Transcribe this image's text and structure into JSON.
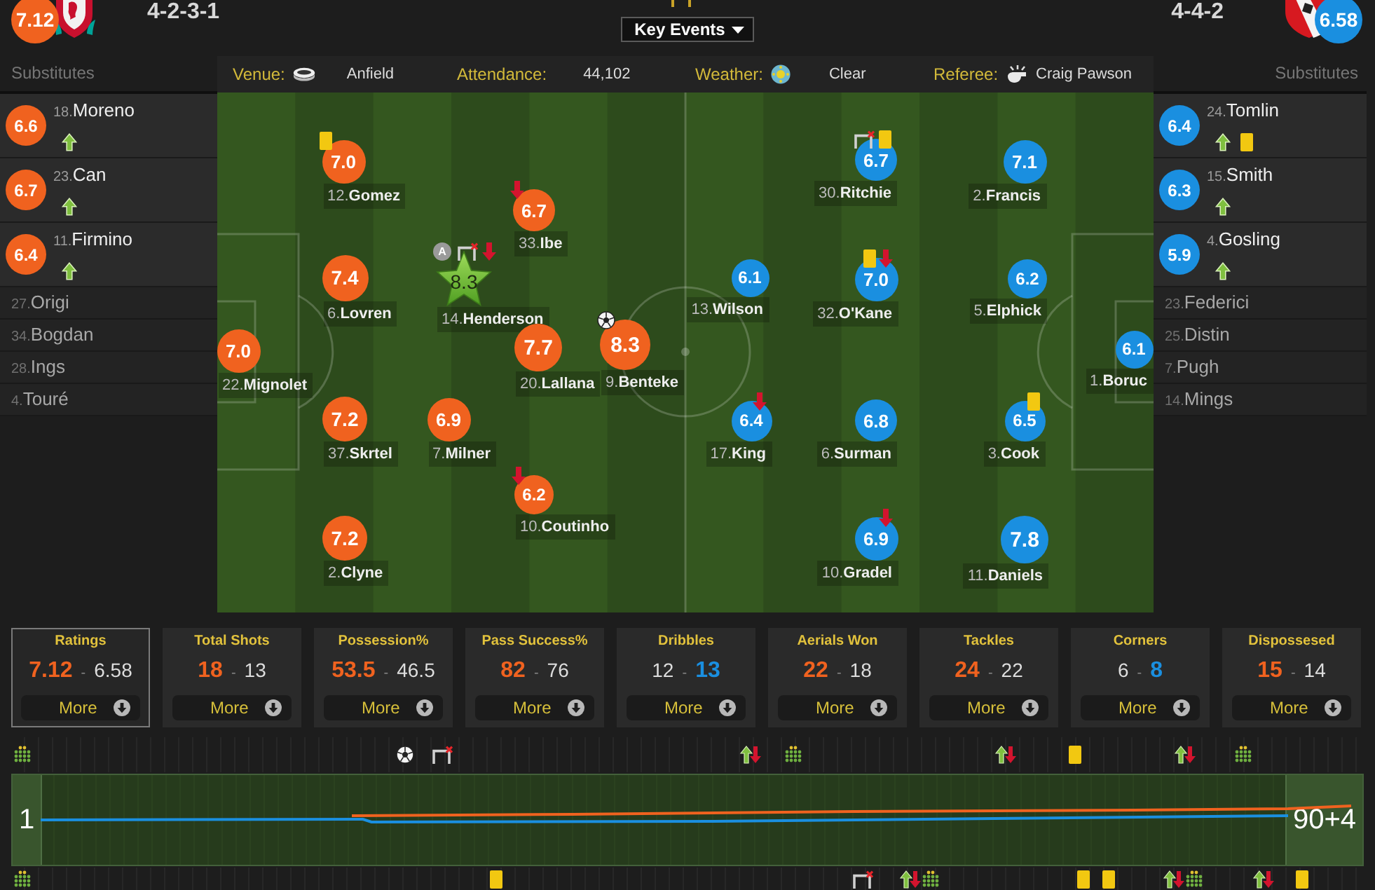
{
  "header": {
    "key_events": "Key Events"
  },
  "teams": [
    {
      "color": "#f0621f",
      "rating": "7.12",
      "formation": "4-2-3-1",
      "substitutes_title": "Substitutes",
      "substitutes": [
        {
          "number": "18.",
          "name": "Moreno",
          "played": true,
          "rating": "6.6",
          "events": [
            {
              "kind": "sub-on"
            }
          ]
        },
        {
          "number": "23.",
          "name": "Can",
          "played": true,
          "rating": "6.7",
          "events": [
            {
              "kind": "sub-on"
            }
          ]
        },
        {
          "number": "11.",
          "name": "Firmino",
          "played": true,
          "rating": "6.4",
          "events": [
            {
              "kind": "sub-on"
            }
          ]
        },
        {
          "number": "27.",
          "name": "Origi",
          "played": false
        },
        {
          "number": "34.",
          "name": "Bogdan",
          "played": false
        },
        {
          "number": "28.",
          "name": "Ings",
          "played": false
        },
        {
          "number": "4.",
          "name": "Touré",
          "played": false
        }
      ],
      "players": [
        {
          "number": "22.",
          "name": "Mignolet",
          "rating": "7.0",
          "motm": false
        },
        {
          "number": "12.",
          "name": "Gomez",
          "rating": "7.0",
          "motm": false,
          "events": [
            {
              "kind": "yellow-card"
            }
          ]
        },
        {
          "number": "6.",
          "name": "Lovren",
          "rating": "7.4",
          "motm": false
        },
        {
          "number": "37.",
          "name": "Skrtel",
          "rating": "7.2",
          "motm": false
        },
        {
          "number": "2.",
          "name": "Clyne",
          "rating": "7.2",
          "motm": false
        },
        {
          "number": "14.",
          "name": "Henderson",
          "rating": "8.3",
          "motm": true,
          "events": [
            {
              "kind": "captain",
              "label": "A"
            },
            {
              "kind": "goalpost"
            },
            {
              "kind": "sub-off"
            }
          ]
        },
        {
          "number": "7.",
          "name": "Milner",
          "rating": "6.9",
          "motm": false
        },
        {
          "number": "33.",
          "name": "Ibe",
          "rating": "6.7",
          "motm": false,
          "events": [
            {
              "kind": "sub-off"
            }
          ]
        },
        {
          "number": "20.",
          "name": "Lallana",
          "rating": "7.7",
          "motm": false
        },
        {
          "number": "10.",
          "name": "Coutinho",
          "rating": "6.2",
          "motm": false,
          "events": [
            {
              "kind": "sub-off"
            }
          ]
        },
        {
          "number": "9.",
          "name": "Benteke",
          "rating": "8.3",
          "motm": false,
          "events": [
            {
              "kind": "goal"
            }
          ]
        }
      ]
    },
    {
      "color": "#1a8fe0",
      "rating": "6.58",
      "formation": "4-4-2",
      "substitutes_title": "Substitutes",
      "substitutes": [
        {
          "number": "24.",
          "name": "Tomlin",
          "played": true,
          "rating": "6.4",
          "events": [
            {
              "kind": "sub-on"
            },
            {
              "kind": "yellow-card"
            }
          ]
        },
        {
          "number": "15.",
          "name": "Smith",
          "played": true,
          "rating": "6.3",
          "events": [
            {
              "kind": "sub-on"
            }
          ]
        },
        {
          "number": "4.",
          "name": "Gosling",
          "played": true,
          "rating": "5.9",
          "events": [
            {
              "kind": "sub-on"
            }
          ]
        },
        {
          "number": "23.",
          "name": "Federici",
          "played": false
        },
        {
          "number": "25.",
          "name": "Distin",
          "played": false
        },
        {
          "number": "7.",
          "name": "Pugh",
          "played": false
        },
        {
          "number": "14.",
          "name": "Mings",
          "played": false
        }
      ],
      "players": [
        {
          "number": "13.",
          "name": "Wilson",
          "rating": "6.1",
          "motm": false
        },
        {
          "number": "17.",
          "name": "King",
          "rating": "6.4",
          "motm": false,
          "events": [
            {
              "kind": "sub-off"
            }
          ]
        },
        {
          "number": "30.",
          "name": "Ritchie",
          "rating": "6.7",
          "motm": false,
          "events": [
            {
              "kind": "goalpost"
            },
            {
              "kind": "yellow-card"
            }
          ]
        },
        {
          "number": "32.",
          "name": "O'Kane",
          "rating": "7.0",
          "motm": false,
          "events": [
            {
              "kind": "yellow-card"
            },
            {
              "kind": "sub-off"
            }
          ]
        },
        {
          "number": "6.",
          "name": "Surman",
          "rating": "6.8",
          "motm": false
        },
        {
          "number": "10.",
          "name": "Gradel",
          "rating": "6.9",
          "motm": false,
          "events": [
            {
              "kind": "sub-off"
            }
          ]
        },
        {
          "number": "2.",
          "name": "Francis",
          "rating": "7.1",
          "motm": false
        },
        {
          "number": "5.",
          "name": "Elphick",
          "rating": "6.2",
          "motm": false
        },
        {
          "number": "3.",
          "name": "Cook",
          "rating": "6.5",
          "motm": false,
          "events": [
            {
              "kind": "yellow-card"
            }
          ]
        },
        {
          "number": "11.",
          "name": "Daniels",
          "rating": "7.8",
          "motm": false
        },
        {
          "number": "1.",
          "name": "Boruc",
          "rating": "6.1",
          "motm": false
        }
      ]
    }
  ],
  "match_info": [
    {
      "kind": "venue",
      "label": "Venue:",
      "value": "Anfield"
    },
    {
      "kind": "attendance",
      "label": "Attendance:",
      "value": "44,102"
    },
    {
      "kind": "weather",
      "label": "Weather:",
      "value": "Clear"
    },
    {
      "kind": "referee",
      "label": "Referee:",
      "value": "Craig Pawson"
    }
  ],
  "stats": [
    {
      "title": "Ratings",
      "home": "7.12",
      "home_lead": true,
      "separator": "-",
      "away": "6.58",
      "away_lead": false,
      "selected": true,
      "button": "More"
    },
    {
      "title": "Total Shots",
      "home": "18",
      "home_lead": true,
      "separator": "-",
      "away": "13",
      "away_lead": false,
      "selected": false,
      "button": "More"
    },
    {
      "title": "Possession%",
      "home": "53.5",
      "home_lead": true,
      "separator": "-",
      "away": "46.5",
      "away_lead": false,
      "selected": false,
      "button": "More"
    },
    {
      "title": "Pass Success%",
      "home": "82",
      "home_lead": true,
      "separator": "-",
      "away": "76",
      "away_lead": false,
      "selected": false,
      "button": "More"
    },
    {
      "title": "Dribbles",
      "home": "12",
      "home_lead": false,
      "separator": "-",
      "away": "13",
      "away_lead": true,
      "selected": false,
      "button": "More"
    },
    {
      "title": "Aerials Won",
      "home": "22",
      "home_lead": true,
      "separator": "-",
      "away": "18",
      "away_lead": false,
      "selected": false,
      "button": "More"
    },
    {
      "title": "Tackles",
      "home": "24",
      "home_lead": true,
      "separator": "-",
      "away": "22",
      "away_lead": false,
      "selected": false,
      "button": "More"
    },
    {
      "title": "Corners",
      "home": "6",
      "home_lead": false,
      "separator": "-",
      "away": "8",
      "away_lead": true,
      "selected": false,
      "button": "More"
    },
    {
      "title": "Dispossesed",
      "home": "15",
      "home_lead": true,
      "separator": "-",
      "away": "14",
      "away_lead": false,
      "selected": false,
      "button": "More"
    }
  ],
  "timeline": {
    "start": "1",
    "end": "90+4",
    "home_events": [
      {
        "kind": "lineup"
      },
      {
        "kind": "goal"
      },
      {
        "kind": "goalpost"
      },
      {
        "kind": "substitution"
      },
      {
        "kind": "lineup"
      },
      {
        "kind": "substitution"
      },
      {
        "kind": "yellow-card"
      },
      {
        "kind": "substitution"
      },
      {
        "kind": "lineup"
      }
    ],
    "away_events": [
      {
        "kind": "lineup"
      },
      {
        "kind": "yellow-card"
      },
      {
        "kind": "goalpost"
      },
      {
        "kind": "substitution"
      },
      {
        "kind": "lineup"
      },
      {
        "kind": "yellow-card"
      },
      {
        "kind": "yellow-card"
      },
      {
        "kind": "substitution"
      },
      {
        "kind": "lineup"
      },
      {
        "kind": "substitution"
      },
      {
        "kind": "yellow-card"
      }
    ]
  }
}
